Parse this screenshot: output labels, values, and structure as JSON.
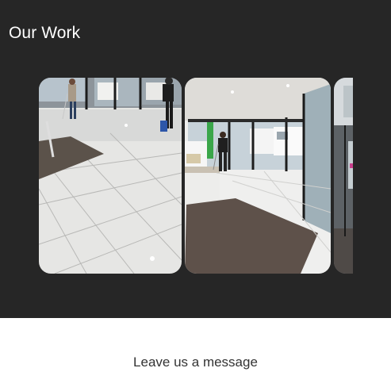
{
  "work": {
    "title": "Our Work",
    "slides": [
      {
        "icon": "lobby-floor-cleaning-photo"
      },
      {
        "icon": "entrance-mopping-photo"
      },
      {
        "icon": "partial-next-photo"
      }
    ]
  },
  "contact": {
    "heading": "Leave us a message"
  },
  "colors": {
    "section_bg": "#262626",
    "title_text": "#ffffff",
    "page_bg": "#ffffff",
    "heading_text": "#333333"
  }
}
